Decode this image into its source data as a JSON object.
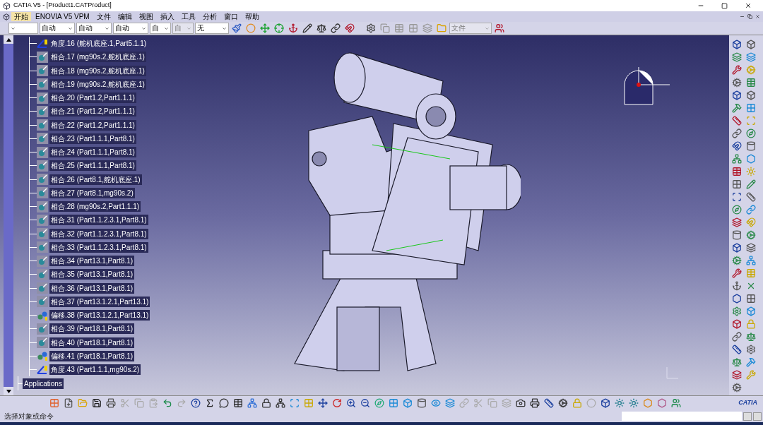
{
  "window": {
    "title": "CATIA V5 - [Product1.CATProduct]"
  },
  "menu": [
    {
      "label": "开始",
      "selected": true
    },
    {
      "label": "ENOVIA V5 VPM",
      "selected": false
    },
    {
      "label": "文件",
      "selected": false
    },
    {
      "label": "编辑",
      "selected": false
    },
    {
      "label": "视图",
      "selected": false
    },
    {
      "label": "插入",
      "selected": false
    },
    {
      "label": "工具",
      "selected": false
    },
    {
      "label": "分析",
      "selected": false
    },
    {
      "label": "窗口",
      "selected": false
    },
    {
      "label": "帮助",
      "selected": false
    }
  ],
  "toolbar_dropdowns": [
    {
      "disabled": false
    },
    {
      "value": "自动",
      "disabled": false
    },
    {
      "value": "自动",
      "disabled": false
    },
    {
      "value": "自动",
      "disabled": false
    },
    {
      "value": "自",
      "disabled": false
    },
    {
      "value": "自",
      "disabled": true
    },
    {
      "value": "无",
      "disabled": false
    }
  ],
  "file_dropdown": {
    "value": "文件",
    "disabled": true
  },
  "tree": {
    "items": [
      {
        "kind": "angle",
        "label": "角度.16 (舵机底座.1,Part5.1.1)",
        "selected": false
      },
      {
        "kind": "coincidence",
        "label": "相合.17 (mg90s.2,舵机底座.1)",
        "selected": true
      },
      {
        "kind": "coincidence",
        "label": "相合.18 (mg90s.2,舵机底座.1)",
        "selected": true
      },
      {
        "kind": "coincidence",
        "label": "相合.19 (mg90s.2,舵机底座.1)",
        "selected": true
      },
      {
        "kind": "coincidence",
        "label": "相合.20 (Part1.2,Part1.1.1)",
        "selected": true
      },
      {
        "kind": "coincidence",
        "label": "相合.21 (Part1.2,Part1.1.1)",
        "selected": true
      },
      {
        "kind": "coincidence",
        "label": "相合.22 (Part1.2,Part1.1.1)",
        "selected": true
      },
      {
        "kind": "coincidence",
        "label": "相合.23 (Part1.1.1,Part8.1)",
        "selected": true
      },
      {
        "kind": "coincidence",
        "label": "相合.24 (Part1.1.1,Part8.1)",
        "selected": true
      },
      {
        "kind": "coincidence",
        "label": "相合.25 (Part1.1.1,Part8.1)",
        "selected": true
      },
      {
        "kind": "coincidence",
        "label": "相合.26 (Part8.1,舵机底座.1)",
        "selected": true
      },
      {
        "kind": "coincidence",
        "label": "相合.27 (Part8.1,mg90s.2)",
        "selected": true
      },
      {
        "kind": "coincidence",
        "label": "相合.28 (mg90s.2,Part1.1.1)",
        "selected": true
      },
      {
        "kind": "coincidence",
        "label": "相合.31 (Part1.1.2.3.1,Part8.1)",
        "selected": true
      },
      {
        "kind": "coincidence",
        "label": "相合.32 (Part1.1.2.3.1,Part8.1)",
        "selected": true
      },
      {
        "kind": "coincidence",
        "label": "相合.33 (Part1.1.2.3.1,Part8.1)",
        "selected": true
      },
      {
        "kind": "coincidence",
        "label": "相合.34 (Part13.1,Part8.1)",
        "selected": true
      },
      {
        "kind": "coincidence",
        "label": "相合.35 (Part13.1,Part8.1)",
        "selected": true
      },
      {
        "kind": "coincidence",
        "label": "相合.36 (Part13.1,Part8.1)",
        "selected": true
      },
      {
        "kind": "coincidence",
        "label": "相合.37 (Part13.1.2.1,Part13.1)",
        "selected": true
      },
      {
        "kind": "offset",
        "label": "偏移.38 (Part13.1.2.1,Part13.1)",
        "selected": true
      },
      {
        "kind": "coincidence",
        "label": "相合.39 (Part18.1,Part8.1)",
        "selected": true
      },
      {
        "kind": "coincidence",
        "label": "相合.40 (Part18.1,Part8.1)",
        "selected": true
      },
      {
        "kind": "offset",
        "label": "偏移.41 (Part18.1,Part8.1)",
        "selected": true
      },
      {
        "kind": "angle",
        "label": "角度.43 (Part1.1.1,mg90s.2)",
        "selected": true
      }
    ],
    "root_item": {
      "label": "Applications",
      "selected": true
    }
  },
  "status_bar": {
    "message": "选择对象或命令"
  },
  "logo_text": "CATIA"
}
